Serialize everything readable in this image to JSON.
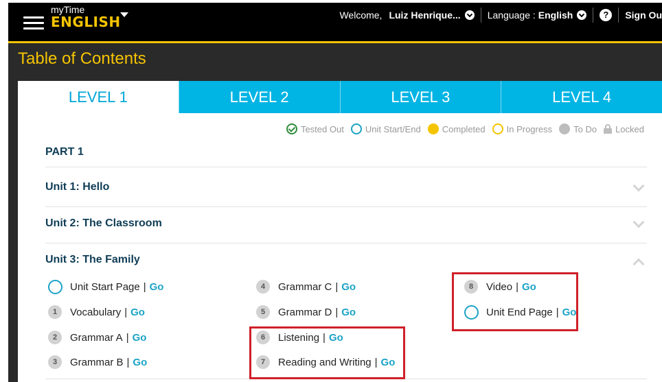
{
  "header": {
    "logo_top": "myTime",
    "logo_bottom": "ENGLISH",
    "welcome": "Welcome,",
    "user_name": "Luiz Henrique...",
    "language_label": "Language :",
    "language_value": "English",
    "help": "?",
    "sign_out": "Sign Ou"
  },
  "page_title": "Table of Contents",
  "tabs": [
    {
      "label": "LEVEL 1",
      "active": true
    },
    {
      "label": "LEVEL 2",
      "active": false
    },
    {
      "label": "LEVEL 3",
      "active": false
    },
    {
      "label": "LEVEL 4",
      "active": false
    }
  ],
  "legend": {
    "tested_out": "Tested Out",
    "unit_start_end": "Unit Start/End",
    "completed": "Completed",
    "in_progress": "In Progress",
    "to_do": "To Do",
    "locked": "Locked"
  },
  "part_title": "PART 1",
  "units": [
    {
      "label": "Unit 1: Hello",
      "expanded": false
    },
    {
      "label": "Unit 2: The Classroom",
      "expanded": false
    },
    {
      "label": "Unit 3: The Family",
      "expanded": true
    }
  ],
  "lessons": {
    "unit_start": "Unit Start Page",
    "vocabulary": "Vocabulary",
    "grammar_a": "Grammar A",
    "grammar_b": "Grammar B",
    "grammar_c": "Grammar C",
    "grammar_d": "Grammar D",
    "listening": "Listening",
    "reading_writing": "Reading and Writing",
    "video": "Video",
    "unit_end": "Unit End Page",
    "numbers": [
      "1",
      "2",
      "3",
      "4",
      "5",
      "6",
      "7",
      "8"
    ],
    "separator": "|",
    "go": "Go"
  },
  "colors": {
    "accent_yellow": "#f5c400",
    "tab_blue": "#00b4e4",
    "link_blue": "#1ba3c6",
    "highlight_red": "#d0202a",
    "unit_text": "#0f3d56"
  }
}
